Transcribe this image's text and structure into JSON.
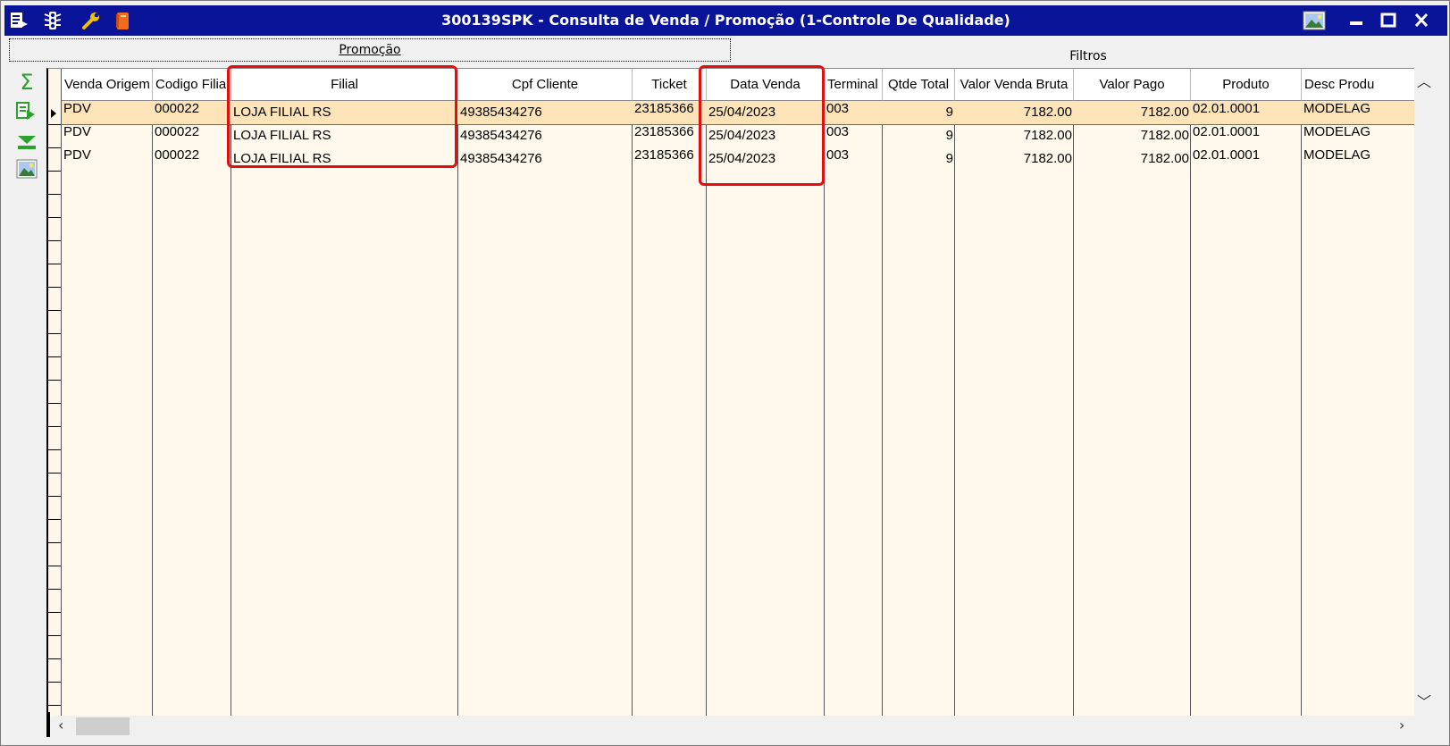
{
  "window": {
    "title": "300139SPK - Consulta de Venda / Promoção (1-Controle De Qualidade)",
    "title_icons": [
      "report-icon",
      "traffic-light-icon",
      "wrench-icon",
      "book-icon"
    ],
    "controls": [
      "picture-icon",
      "minimize-icon",
      "maximize-icon",
      "close-icon"
    ],
    "title_bar_color": "#0a1498"
  },
  "tabs": {
    "promocao": "Promoção",
    "filtros": "Filtros"
  },
  "toolbar": {
    "icons": [
      "sum-icon",
      "export-icon",
      "expand-down-icon",
      "image-icon"
    ],
    "sum_glyph": "Σ"
  },
  "grid": {
    "columns": [
      "Venda Origem",
      "Codigo Filial",
      "Filial",
      "Cpf Cliente",
      "Ticket",
      "Data Venda",
      "Terminal",
      "Qtde Total",
      "Valor Venda Bruta",
      "Valor Pago",
      "Produto",
      "Desc Produ"
    ],
    "rows": [
      [
        "PDV",
        "000022",
        "LOJA FILIAL RS",
        "49385434276",
        "23185366",
        "25/04/2023",
        "003",
        "9",
        "7182.00",
        "7182.00",
        "02.01.0001",
        "MODELAG"
      ],
      [
        "PDV",
        "000022",
        "LOJA FILIAL RS",
        "49385434276",
        "23185366",
        "25/04/2023",
        "003",
        "9",
        "7182.00",
        "7182.00",
        "02.01.0001",
        "MODELAG"
      ],
      [
        "PDV",
        "000022",
        "LOJA FILIAL RS",
        "49385434276",
        "23185366",
        "25/04/2023",
        "003",
        "9",
        "7182.00",
        "7182.00",
        "02.01.0001",
        "MODELAG"
      ]
    ],
    "selected_row": 0,
    "row_background": "#fff8ec",
    "selected_background": "#fde3b8"
  },
  "highlight_color": "#e01010",
  "highlighted_columns": [
    "Filial",
    "Data Venda"
  ]
}
